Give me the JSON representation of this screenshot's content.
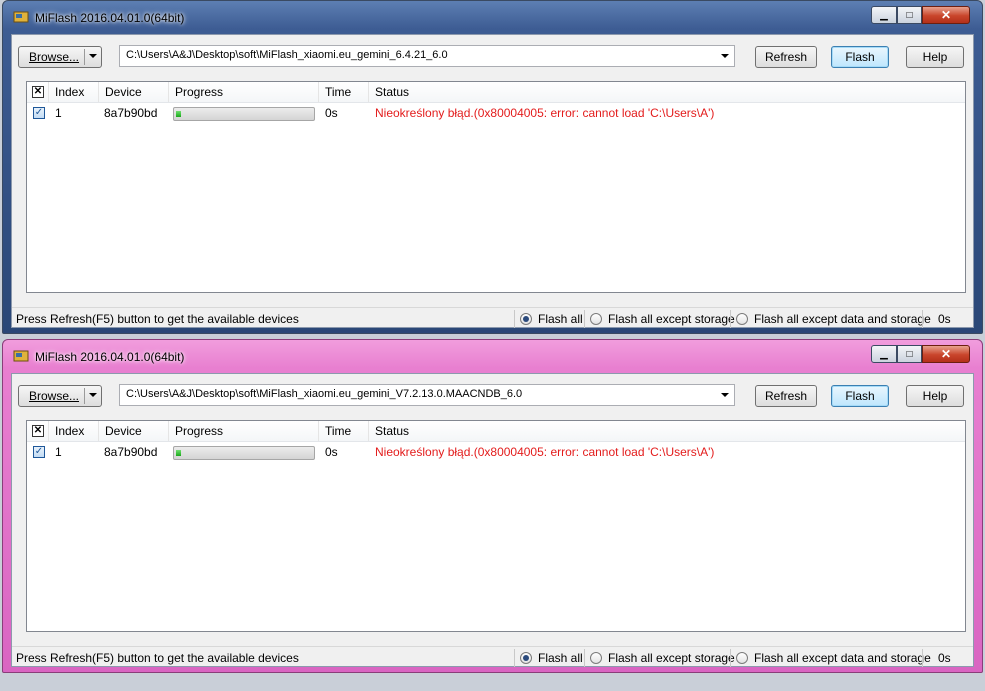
{
  "windows": [
    {
      "title": "MiFlash 2016.04.01.0(64bit)",
      "browse_label": "Browse...",
      "path": "C:\\Users\\A&J\\Desktop\\soft\\MiFlash_xiaomi.eu_gemini_6.4.21_6.0",
      "buttons": {
        "refresh": "Refresh",
        "flash": "Flash",
        "help": "Help"
      },
      "columns": {
        "index": "Index",
        "device": "Device",
        "progress": "Progress",
        "time": "Time",
        "status": "Status"
      },
      "rows": [
        {
          "index": "1",
          "device": "8a7b90bd",
          "progress": 0.03,
          "time": "0s",
          "status": "Nieokreślony błąd.(0x80004005: error: cannot load 'C:\\Users\\A')"
        }
      ],
      "statusbar": {
        "text": "Press Refresh(F5) button to get the available devices",
        "options": [
          "Flash all",
          "Flash all except storage",
          "Flash all except data and storage"
        ],
        "selected": "Flash all",
        "time": "0s"
      }
    },
    {
      "title": "MiFlash 2016.04.01.0(64bit)",
      "browse_label": "Browse...",
      "path": "C:\\Users\\A&J\\Desktop\\soft\\MiFlash_xiaomi.eu_gemini_V7.2.13.0.MAACNDB_6.0",
      "buttons": {
        "refresh": "Refresh",
        "flash": "Flash",
        "help": "Help"
      },
      "columns": {
        "index": "Index",
        "device": "Device",
        "progress": "Progress",
        "time": "Time",
        "status": "Status"
      },
      "rows": [
        {
          "index": "1",
          "device": "8a7b90bd",
          "progress": 0.03,
          "time": "0s",
          "status": "Nieokreślony błąd.(0x80004005: error: cannot load 'C:\\Users\\A')"
        }
      ],
      "statusbar": {
        "text": "Press Refresh(F5) button to get the available devices",
        "options": [
          "Flash all",
          "Flash all except storage",
          "Flash all except data and storage"
        ],
        "selected": "Flash all",
        "time": "0s"
      }
    }
  ],
  "colors": {
    "error_text": "#e31c1c",
    "progress_fill": "#1aa81a",
    "titlebar_blue": "#3d5c93",
    "titlebar_pink": "#e87fd0"
  }
}
